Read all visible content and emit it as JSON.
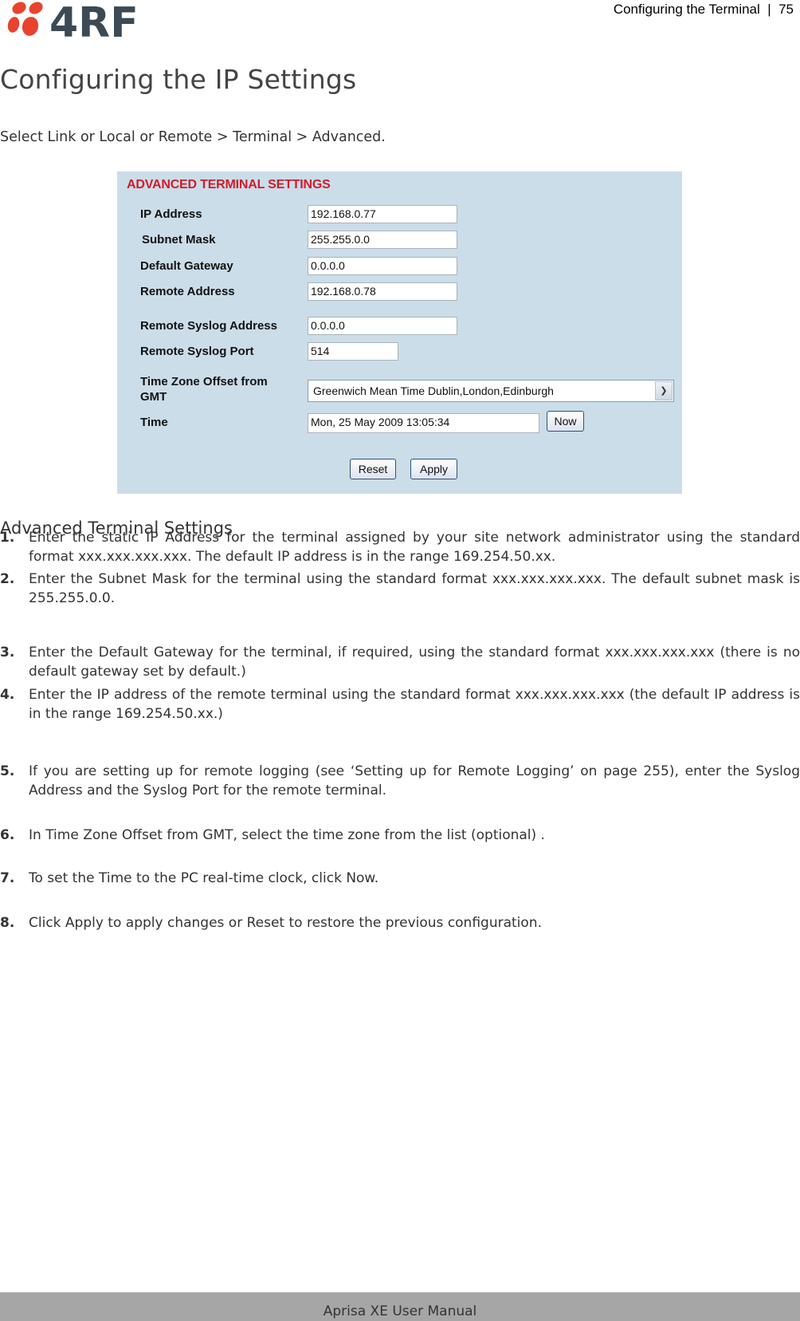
{
  "header": {
    "logo_text": "4RF",
    "running_header": "Configuring the Terminal  |  75"
  },
  "page_title": "Configuring the IP Settings",
  "intro": "Select Link or Local or Remote > Terminal > Advanced.",
  "panel": {
    "title": "ADVANCED TERMINAL SETTINGS",
    "fields": {
      "ip_address": {
        "label": "IP Address",
        "value": "192.168.0.77"
      },
      "subnet_mask": {
        "label": "Subnet Mask",
        "value": "255.255.0.0"
      },
      "default_gateway": {
        "label": "Default Gateway",
        "value": "0.0.0.0"
      },
      "remote_address": {
        "label": "Remote Address",
        "value": "192.168.0.78"
      },
      "remote_syslog_address": {
        "label": "Remote Syslog Address",
        "value": "0.0.0.0"
      },
      "remote_syslog_port": {
        "label": "Remote Syslog Port",
        "value": "514"
      },
      "time_zone": {
        "label_line1": "Time Zone Offset from",
        "label_line2": "GMT",
        "value": "Greenwich Mean Time Dublin,London,Edinburgh"
      },
      "time": {
        "label": "Time",
        "value": "Mon, 25 May 2009 13:05:34"
      }
    },
    "buttons": {
      "now": "Now",
      "reset": "Reset",
      "apply": "Apply"
    }
  },
  "caption": "Advanced Terminal Settings",
  "steps": [
    {
      "num": "1.",
      "text": "Enter the static IP Address for the terminal assigned by your site network administrator using the standard format xxx.xxx.xxx.xxx. The default IP address is in the range 169.254.50.xx."
    },
    {
      "num": "2.",
      "text": "Enter the Subnet Mask for the terminal using the standard format xxx.xxx.xxx.xxx. The default subnet mask is 255.255.0.0."
    },
    {
      "num": "3.",
      "text": "Enter the Default Gateway for the terminal, if required, using the standard format xxx.xxx.xxx.xxx (there is no default gateway set by default.)"
    },
    {
      "num": "4.",
      "text": "Enter the IP address of the remote terminal using the standard format xxx.xxx.xxx.xxx (the default IP address is in the range 169.254.50.xx.)"
    },
    {
      "num": "5.",
      "text": "If you are setting up for remote logging (see ‘Setting up for Remote Logging’ on page 255), enter the Syslog Address and the Syslog Port for the remote terminal."
    },
    {
      "num": "6.",
      "text": "In Time Zone Offset from GMT, select the time zone from the list (optional) ."
    },
    {
      "num": "7.",
      "text": "To set the Time to the PC real-time clock, click Now."
    },
    {
      "num": "8.",
      "text": "Click Apply to apply changes or Reset to restore the previous configuration."
    }
  ],
  "footer": "Aprisa XE User Manual"
}
